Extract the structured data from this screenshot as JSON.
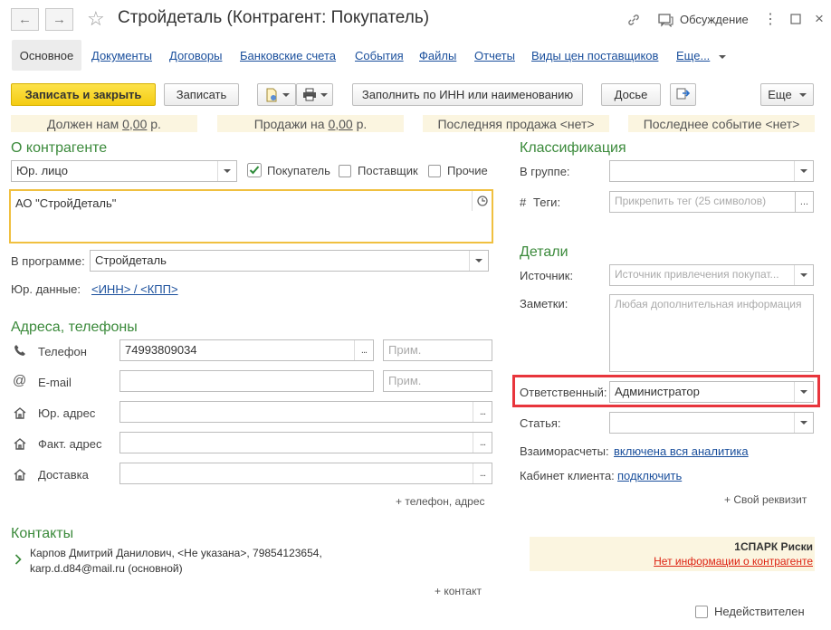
{
  "window": {
    "title": "Стройдеталь (Контрагент: Покупатель)",
    "discussion_label": "Обсуждение"
  },
  "tabs": [
    {
      "label": "Основное"
    },
    {
      "label": "Документы"
    },
    {
      "label": "Договоры"
    },
    {
      "label": "Банковские счета"
    },
    {
      "label": "События"
    },
    {
      "label": "Файлы"
    },
    {
      "label": "Отчеты"
    },
    {
      "label": "Виды цен поставщиков"
    },
    {
      "label": "Еще..."
    }
  ],
  "toolbar": {
    "save_close": "Записать и закрыть",
    "save": "Записать",
    "fill_inn": "Заполнить по ИНН или наименованию",
    "dossier": "Досье",
    "more": "Еще"
  },
  "infobar": {
    "owes_label": "Должен нам",
    "owes_value": "0,00",
    "owes_unit": "р.",
    "sales_label": "Продажи на",
    "sales_value": "0,00",
    "sales_unit": "р.",
    "last_sale": "Последняя продажа <нет>",
    "last_event": "Последнее событие <нет>"
  },
  "about": {
    "section_title": "О контрагенте",
    "entity_type": "Юр. лицо",
    "cb_buyer": "Покупатель",
    "cb_supplier": "Поставщик",
    "cb_other": "Прочие",
    "full_name": "АО \"СтройДеталь\"",
    "in_program_label": "В программе:",
    "in_program_value": "Стройдеталь",
    "legal_label": "Юр. данные:",
    "legal_link": "<ИНН> / <КПП>"
  },
  "addresses": {
    "section_title": "Адреса, телефоны",
    "phone_label": "Телефон",
    "phone_value": "74993809034",
    "phone_note_ph": "Прим.",
    "email_label": "E-mail",
    "email_note_ph": "Прим.",
    "legal_addr_label": "Юр. адрес",
    "fact_addr_label": "Факт. адрес",
    "delivery_label": "Доставка",
    "add_link": "+ телефон, адрес"
  },
  "contacts": {
    "section_title": "Контакты",
    "line1": "Карпов Дмитрий Данилович, <Не указана>, 79854123654,",
    "line2": "karp.d.d84@mail.ru (основной)",
    "add_link": "+ контакт"
  },
  "classification": {
    "section_title": "Классификация",
    "group_label": "В группе:",
    "tags_hash": "#",
    "tags_label": "Теги:",
    "tags_ph": "Прикрепить тег (25 символов)"
  },
  "details": {
    "section_title": "Детали",
    "source_label": "Источник:",
    "source_ph": "Источник привлечения покупат...",
    "notes_label": "Заметки:",
    "notes_ph": "Любая дополнительная информация",
    "responsible_label": "Ответственный:",
    "responsible_value": "Администратор",
    "article_label": "Статья:",
    "settlements_label": "Взаиморасчеты:",
    "settlements_link": "включена вся аналитика",
    "cabinet_label": "Кабинет клиента:",
    "cabinet_link": "подключить",
    "own_req_link": "+ Свой реквизит"
  },
  "spark": {
    "title": "1СПАРК Риски",
    "link": "Нет информации о контрагенте"
  },
  "footer": {
    "invalid_label": "Недействителен"
  },
  "colors": {
    "accent_green": "#3b8a3b",
    "link_blue": "#1a4f9c",
    "highlight_red": "#e8353c",
    "primary_yellow": "#f4cc13"
  }
}
